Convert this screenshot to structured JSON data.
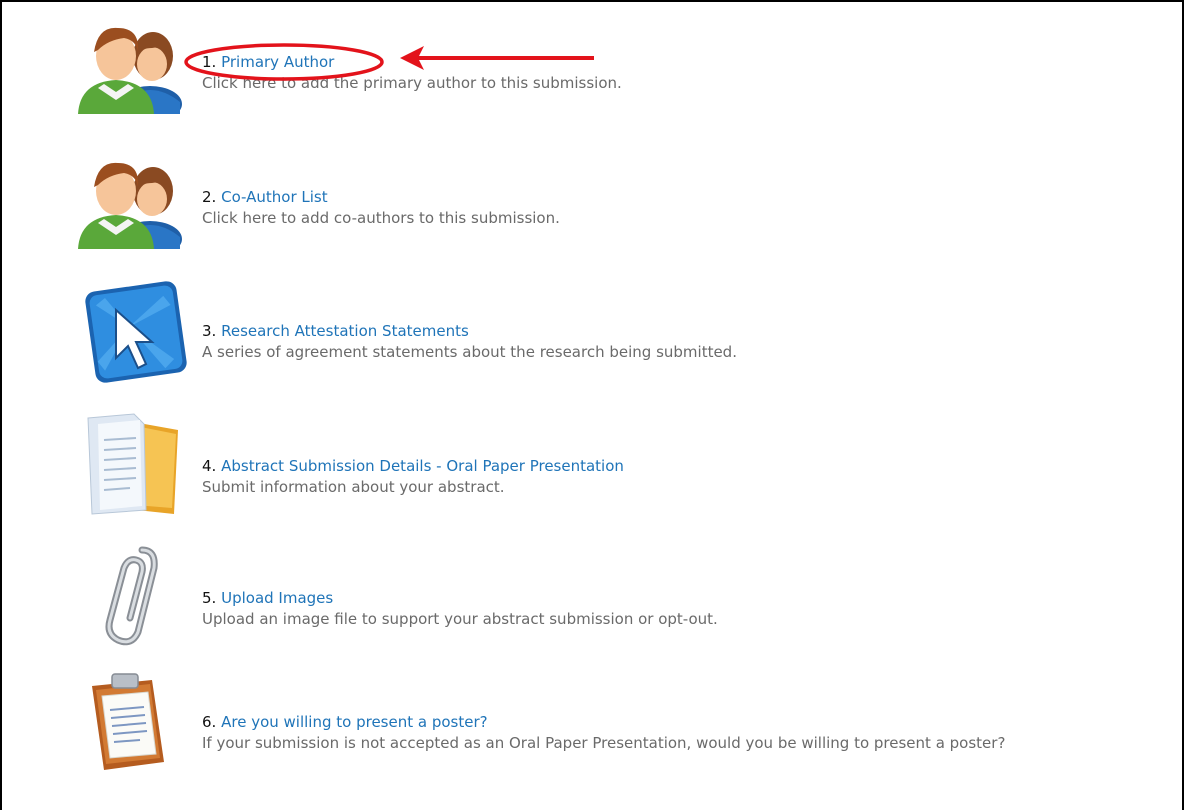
{
  "steps": [
    {
      "number": "1.",
      "title": "Primary Author",
      "description": "Click here to add the primary author to this submission.",
      "icon": "authors-icon"
    },
    {
      "number": "2.",
      "title": "Co-Author List",
      "description": "Click here to add co-authors to this submission.",
      "icon": "authors-icon"
    },
    {
      "number": "3.",
      "title": "Research Attestation Statements",
      "description": "A series of agreement statements about the research being submitted.",
      "icon": "cursor-arrow-icon"
    },
    {
      "number": "4.",
      "title": "Abstract Submission Details - Oral Paper Presentation",
      "description": "Submit information about your abstract.",
      "icon": "documents-folder-icon"
    },
    {
      "number": "5.",
      "title": "Upload Images",
      "description": "Upload an image file to support your abstract submission or opt-out.",
      "icon": "paperclip-icon"
    },
    {
      "number": "6.",
      "title": "Are you willing to present a poster?",
      "description": "If your submission is not accepted as an Oral Paper Presentation, would you be willing to present a poster?",
      "icon": "clipboard-icon"
    }
  ],
  "annotation": {
    "color": "#e3131b",
    "marks": [
      "highlight-ellipse",
      "pointer-arrow"
    ]
  }
}
